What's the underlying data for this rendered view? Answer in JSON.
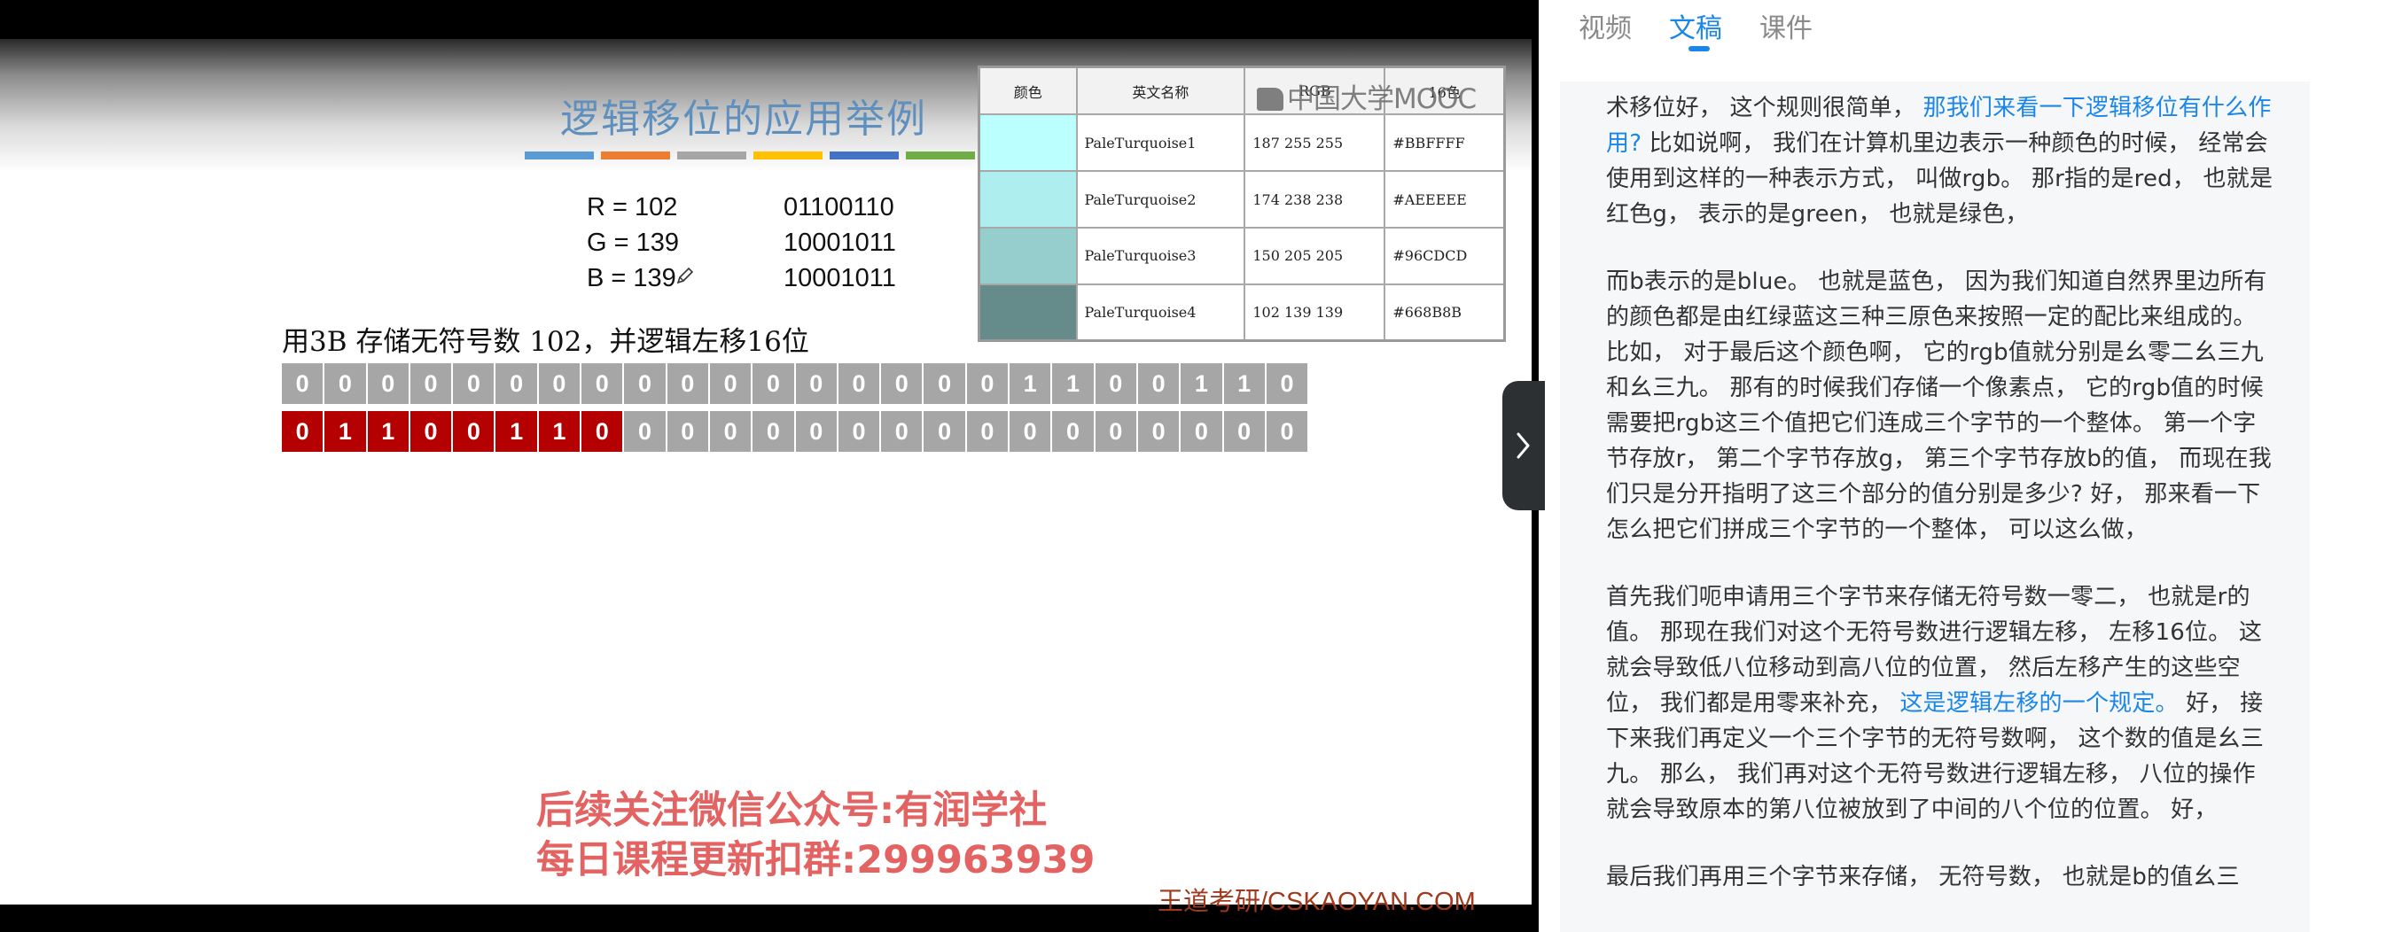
{
  "slide": {
    "title": "逻辑移位的应用举例",
    "strip_colors": [
      "#5b9bd5",
      "#ed7d31",
      "#a5a5a5",
      "#ffc000",
      "#4472c4",
      "#70ad47"
    ],
    "rgb": [
      {
        "label": "R = 102",
        "bits": "01100110"
      },
      {
        "label": "G = 139",
        "bits": "10001011"
      },
      {
        "label": "B = 139",
        "bits": "10001011"
      }
    ],
    "color_table": {
      "headers": [
        "颜色",
        "英文名称",
        "RGB",
        "16色"
      ],
      "rows": [
        {
          "swatch": "#BBFFFF",
          "name": "PaleTurquoise1",
          "rgb": "187 255 255",
          "hex": "#BBFFFF"
        },
        {
          "swatch": "#AEEEEE",
          "name": "PaleTurquoise2",
          "rgb": "174 238 238",
          "hex": "#AEEEEE"
        },
        {
          "swatch": "#96CDCD",
          "name": "PaleTurquoise3",
          "rgb": "150 205 205",
          "hex": "#96CDCD"
        },
        {
          "swatch": "#668B8B",
          "name": "PaleTurquoise4",
          "rgb": "102 139 139",
          "hex": "#668B8B"
        }
      ]
    },
    "mooc_logo": "中国大学MOOC",
    "store_label": "用3B 存储无符号数 102，并逻辑左移16位",
    "bits_before": "000000000000000001100110",
    "bits_after": "011001100000000000000000",
    "shifted_bit_count": 8,
    "promo_line1": "后续关注微信公众号:有润学社",
    "promo_line2": "每日课程更新扣群:299963939",
    "brand": "王道考研/CSKAOYAN.COM",
    "toggle_icon": "chevron-right-icon"
  },
  "tabs": [
    "视频",
    "文稿",
    "课件"
  ],
  "active_tab": 1,
  "transcript": [
    [
      {
        "text": "术移位好， 这个规则很简单， ",
        "hl": false
      },
      {
        "text": "那我们来看一下逻辑移位有什么作用?",
        "hl": true
      },
      {
        "text": " 比如说啊， 我们在计算机里边表示一种颜色的时候， 经常会使用到这样的一种表示方式， 叫做rgb。 那r指的是red， 也就是红色g， 表示的是green， 也就是绿色，",
        "hl": false
      }
    ],
    [
      {
        "text": "而b表示的是blue。 也就是蓝色， 因为我们知道自然界里边所有的颜色都是由红绿蓝这三种三原色来按照一定的配比来组成的。 比如， 对于最后这个颜色啊， 它的rgb值就分别是幺零二幺三九和幺三九。 那有的时候我们存储一个像素点， 它的rgb值的时候需要把rgb这三个值把它们连成三个字节的一个整体。 第一个字节存放r， 第二个字节存放g， 第三个字节存放b的值， 而现在我们只是分开指明了这三个部分的值分别是多少? 好， 那来看一下怎么把它们拼成三个字节的一个整体， 可以这么做，",
        "hl": false
      }
    ],
    [
      {
        "text": "首先我们呃申请用三个字节来存储无符号数一零二， 也就是r的值。 那现在我们对这个无符号数进行逻辑左移， 左移16位。 这就会导致低八位移动到高八位的位置， 然后左移产生的这些空位， 我们都是用零来补充， ",
        "hl": false
      },
      {
        "text": "这是逻辑左移的一个规定。",
        "hl": true
      },
      {
        "text": " 好， 接下来我们再定义一个三个字节的无符号数啊， 这个数的值是幺三九。 那么， 我们再对这个无符号数进行逻辑左移， 八位的操作就会导致原本的第八位被放到了中间的八个位的位置。 好，",
        "hl": false
      }
    ],
    [
      {
        "text": "最后我们再用三个字节来存储， 无符号数， 也就是b的值幺三",
        "hl": false
      }
    ]
  ]
}
